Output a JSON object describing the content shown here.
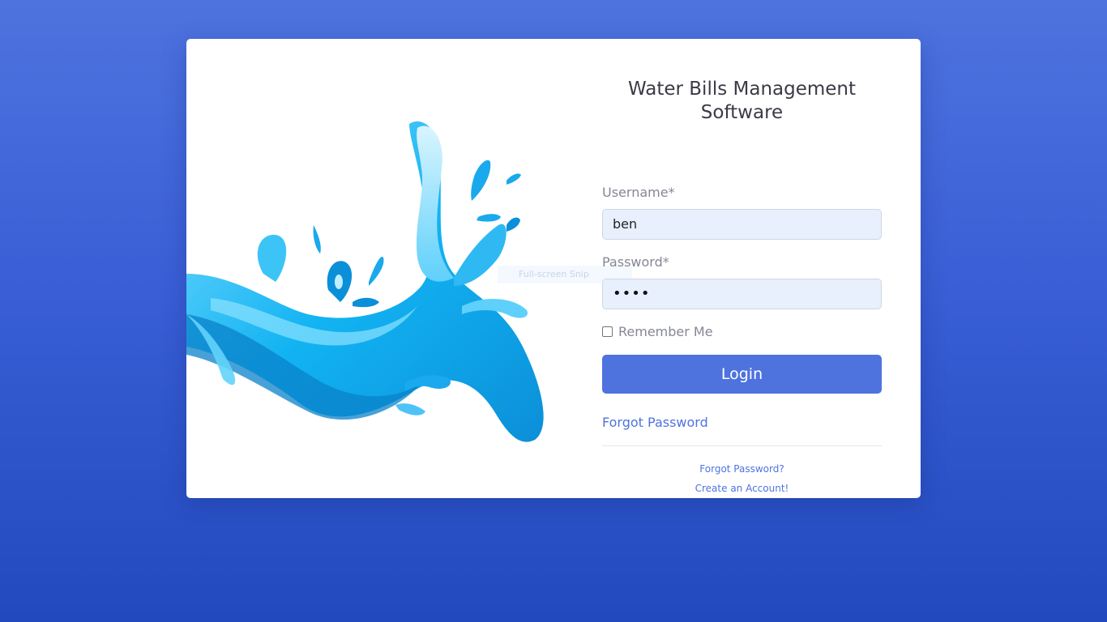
{
  "title": "Water Bills Management Software",
  "title_line1": "Water Bills Management",
  "title_line2": "Software",
  "username": {
    "label": "Username*",
    "value": "ben"
  },
  "password": {
    "label": "Password*",
    "masked_value": "••••"
  },
  "remember_me": {
    "label": "Remember Me",
    "checked": false
  },
  "login_button": "Login",
  "forgot_password_link": "Forgot Password",
  "footer_links": {
    "forgot_password": "Forgot Password?",
    "create_account": "Create an Account!"
  },
  "overlay_text": "Full-screen Snip",
  "colors": {
    "background_top": "#4e73df",
    "background_bottom": "#224abe",
    "primary": "#4e73df",
    "input_bg": "#e8f0fe",
    "water_light": "#4fc3f7",
    "water_dark": "#0288d1"
  },
  "illustration": "water-splash"
}
